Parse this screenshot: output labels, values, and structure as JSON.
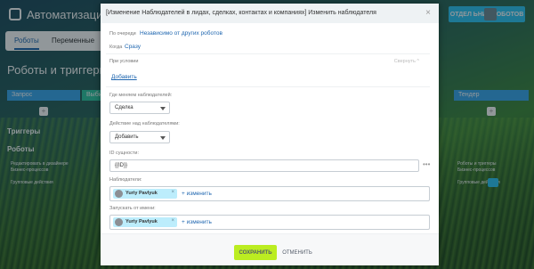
{
  "background": {
    "app_title": "Автоматизация пр",
    "robots_button": "ОТДЕЛ ЬНИК РОБОТОВ",
    "tabs": [
      "Роботы",
      "Переменные"
    ],
    "page_title": "Роботы и триггеры",
    "stages_left": [
      "Запрос",
      "Выби"
    ],
    "stage_right": "Тендер",
    "triggers_label": "Триггеры",
    "robots_label": "Роботы",
    "robot_card_left": "Редактировать в дизайнере\nБизнес-процессов",
    "robot_card_right": "Роботы и триггеры\nБизнес-процессов",
    "group_actions": "Групповые действия"
  },
  "modal": {
    "title": "[Изменение Наблюдателей в лидах, сделках, контактах и компаниях] Изменить наблюдателя",
    "close": "×",
    "queue_label": "По очереди",
    "queue_value": "Независимо от других роботов",
    "when_label": "Когда",
    "when_value": "Сразу",
    "condition_label": "При условии",
    "collapse_label": "Свернуть ^",
    "add_link": "Добавить",
    "where_label": "Где меняем наблюдателей:",
    "where_value": "Сделка",
    "action_label": "Действие над наблюдателями:",
    "action_value": "Добавить",
    "entity_id_label": "ID сущности:",
    "entity_id_value": "{{ID}}",
    "dots": "•••",
    "observers_label": "Наблюдатели:",
    "observer_name": "Yuriy Pavlyuk",
    "add_observer": "+ изменить",
    "run_as_label": "Запускать от имени:",
    "run_as_name": "Yuriy Pavlyuk",
    "add_run_as": "+ изменить",
    "save_button": "СОХРАНИТЬ",
    "cancel_button": "ОТМЕНИТЬ"
  },
  "colors": {
    "link": "#2067b0",
    "save": "#bbed21",
    "chip": "#bcedfc",
    "robots_button": "#2fc6f6"
  }
}
